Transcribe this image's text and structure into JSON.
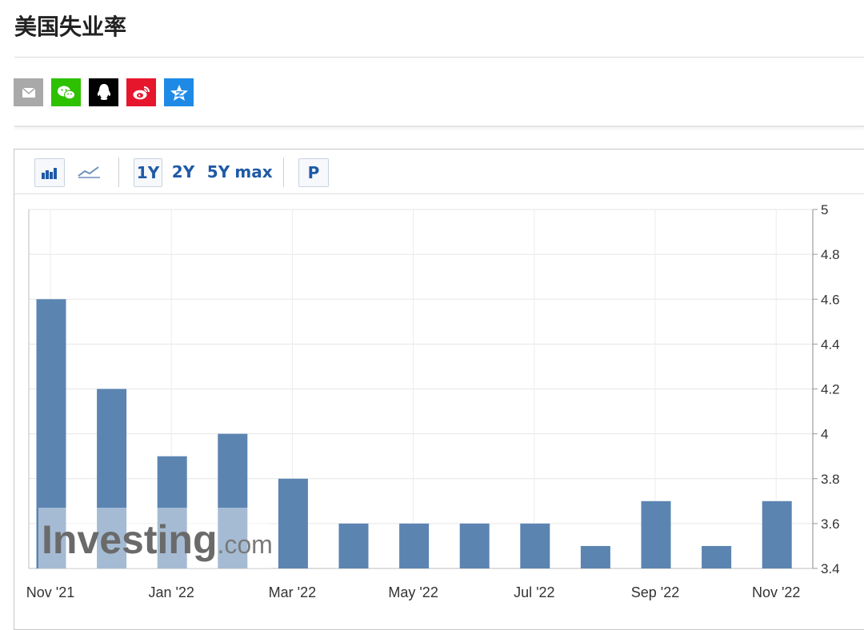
{
  "page": {
    "title": "美国失业率"
  },
  "toolbar": {
    "range_1y": "1Y",
    "range_2y": "2Y",
    "range_5y": "5Y",
    "range_max": "max",
    "p_button": "P"
  },
  "colors": {
    "bar": "#5b84b1",
    "bar_light": "#a8bfdb",
    "weibo": "#e6162d",
    "wechat": "#2dc100",
    "qzone": "#1e8ae6"
  },
  "share_icons": [
    "mail-icon",
    "wechat-icon",
    "qq-icon",
    "weibo-icon",
    "qzone-icon"
  ],
  "chart_data": {
    "type": "bar",
    "categories": [
      "Nov '21",
      "Dec '21",
      "Jan '22",
      "Feb '22",
      "Mar '22",
      "Apr '22",
      "May '22",
      "Jun '22",
      "Jul '22",
      "Aug '22",
      "Sep '22",
      "Oct '22",
      "Nov '22"
    ],
    "x_tick_labels": [
      "Nov '21",
      "Jan '22",
      "Mar '22",
      "May '22",
      "Jul '22",
      "Sep '22",
      "Nov '22"
    ],
    "values": [
      4.6,
      4.2,
      3.9,
      4.0,
      3.8,
      3.6,
      3.6,
      3.6,
      3.6,
      3.5,
      3.7,
      3.5,
      3.7
    ],
    "y_tick_labels": [
      "5",
      "4.8",
      "4.6",
      "4.4",
      "4.2",
      "4",
      "3.8",
      "3.6",
      "3.4"
    ],
    "ylim": [
      3.4,
      5
    ],
    "y_axis_side": "right",
    "grid": true,
    "watermark": "Investing.com"
  }
}
